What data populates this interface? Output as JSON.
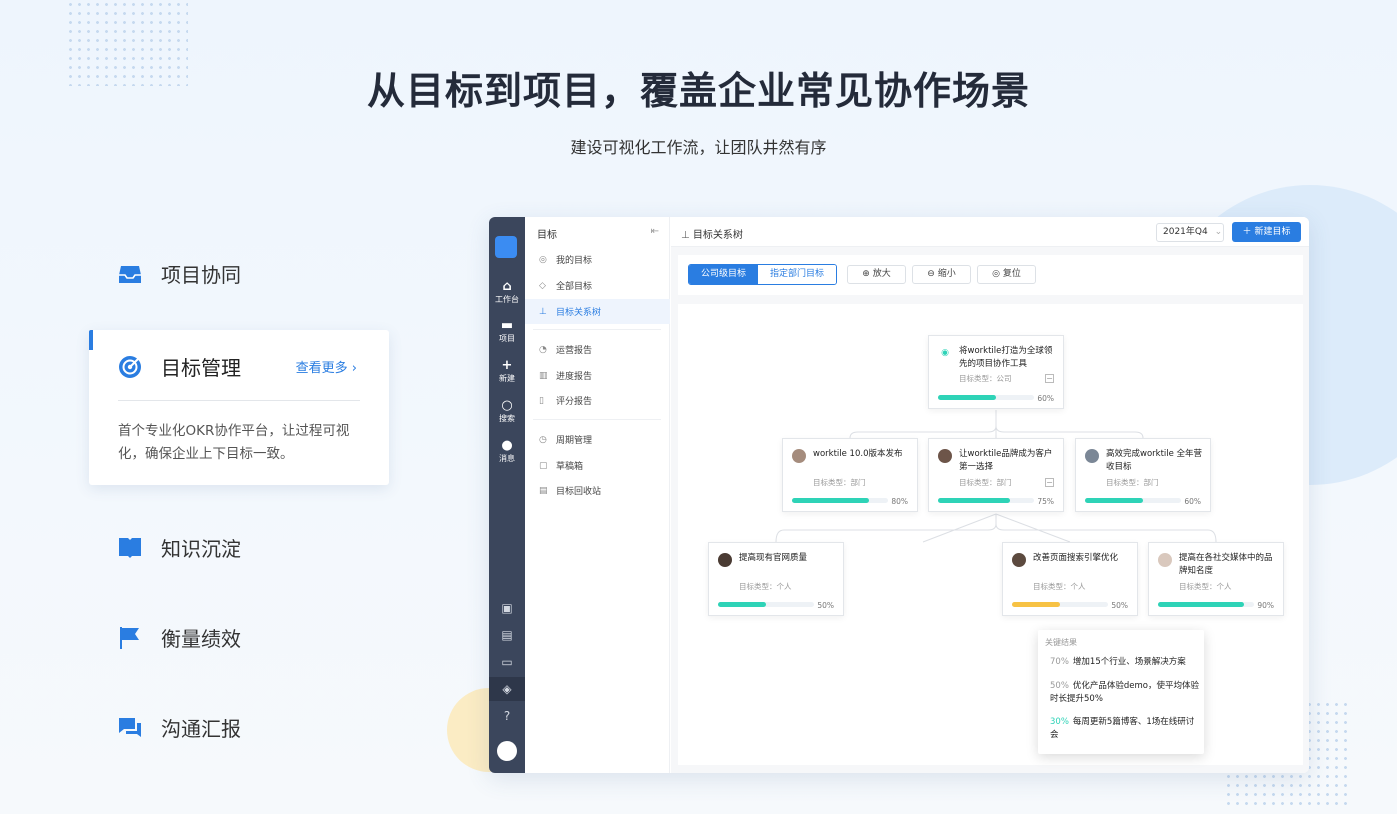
{
  "hero": {
    "title": "从目标到项目，覆盖企业常见协作场景",
    "subtitle": "建设可视化工作流，让团队井然有序"
  },
  "features": [
    {
      "label": "项目协同",
      "icon": "inbox-icon"
    },
    {
      "label": "目标管理",
      "icon": "target-icon",
      "more": "查看更多",
      "desc": "首个专业化OKR协作平台，让过程可视化，确保企业上下目标一致。"
    },
    {
      "label": "知识沉淀",
      "icon": "book-icon"
    },
    {
      "label": "衡量绩效",
      "icon": "flag-icon"
    },
    {
      "label": "沟通汇报",
      "icon": "chat-icon"
    }
  ],
  "rail": {
    "items": [
      {
        "label": "工作台",
        "icon": "home-icon"
      },
      {
        "label": "项目",
        "icon": "inbox-icon"
      },
      {
        "label": "新建",
        "icon": "plus-icon"
      },
      {
        "label": "搜索",
        "icon": "search-icon"
      },
      {
        "label": "消息",
        "icon": "message-icon"
      }
    ]
  },
  "sidebar": {
    "title": "目标",
    "items": [
      {
        "label": "我的目标",
        "icon": "target-icon"
      },
      {
        "label": "全部目标",
        "icon": "layers-icon"
      },
      {
        "label": "目标关系树",
        "icon": "tree-icon",
        "active": true
      },
      {
        "label": "运营报告",
        "icon": "pie-icon"
      },
      {
        "label": "进度报告",
        "icon": "chart-icon"
      },
      {
        "label": "评分报告",
        "icon": "doc-icon"
      },
      {
        "label": "周期管理",
        "icon": "clock-icon"
      },
      {
        "label": "草稿箱",
        "icon": "draft-icon"
      },
      {
        "label": "目标回收站",
        "icon": "trash-icon"
      }
    ]
  },
  "topbar": {
    "title": "目标关系树",
    "period": "2021年Q4",
    "new_button": "新建目标"
  },
  "toolbar": {
    "seg_company": "公司级目标",
    "seg_dept": "指定部门目标",
    "zoom_in": "放大",
    "zoom_out": "缩小",
    "reset": "复位"
  },
  "tree": {
    "root": {
      "title": "将worktile打造为全球领先的项目协作工具",
      "type": "目标类型：公司",
      "progress": 60,
      "progress_label": "60%"
    },
    "level1": [
      {
        "title": "worktile 10.0版本发布",
        "type": "目标类型：部门",
        "progress": 80,
        "progress_label": "80%"
      },
      {
        "title": "让worktile品牌成为客户第一选择",
        "type": "目标类型：部门",
        "progress": 75,
        "progress_label": "75%"
      },
      {
        "title": "高效完成worktile 全年营收目标",
        "type": "目标类型：部门",
        "progress": 60,
        "progress_label": "60%"
      }
    ],
    "level2": [
      {
        "title": "提高现有官网质量",
        "type": "目标类型：个人",
        "progress": 50,
        "progress_label": "50%"
      },
      {
        "title": "改善页面搜索引擎优化",
        "type": "目标类型：个人",
        "progress": 50,
        "progress_label": "50%"
      },
      {
        "title": "提高在各社交媒体中的品牌知名度",
        "type": "目标类型：个人",
        "progress": 90,
        "progress_label": "90%"
      }
    ],
    "tooltip": {
      "title": "关键结果",
      "items": [
        {
          "pct": "70%",
          "text": "增加15个行业、场景解决方案"
        },
        {
          "pct": "50%",
          "text": "优化产品体验demo，使平均体验时长提升50%"
        },
        {
          "pct": "30%",
          "text": "每周更新5篇博客、1场在线研讨会"
        }
      ]
    }
  },
  "colors": {
    "accent": "#2a7de1",
    "progress_green": "#2ed3b7",
    "progress_yellow": "#f7c244",
    "rail_bg": "#3b465c"
  }
}
